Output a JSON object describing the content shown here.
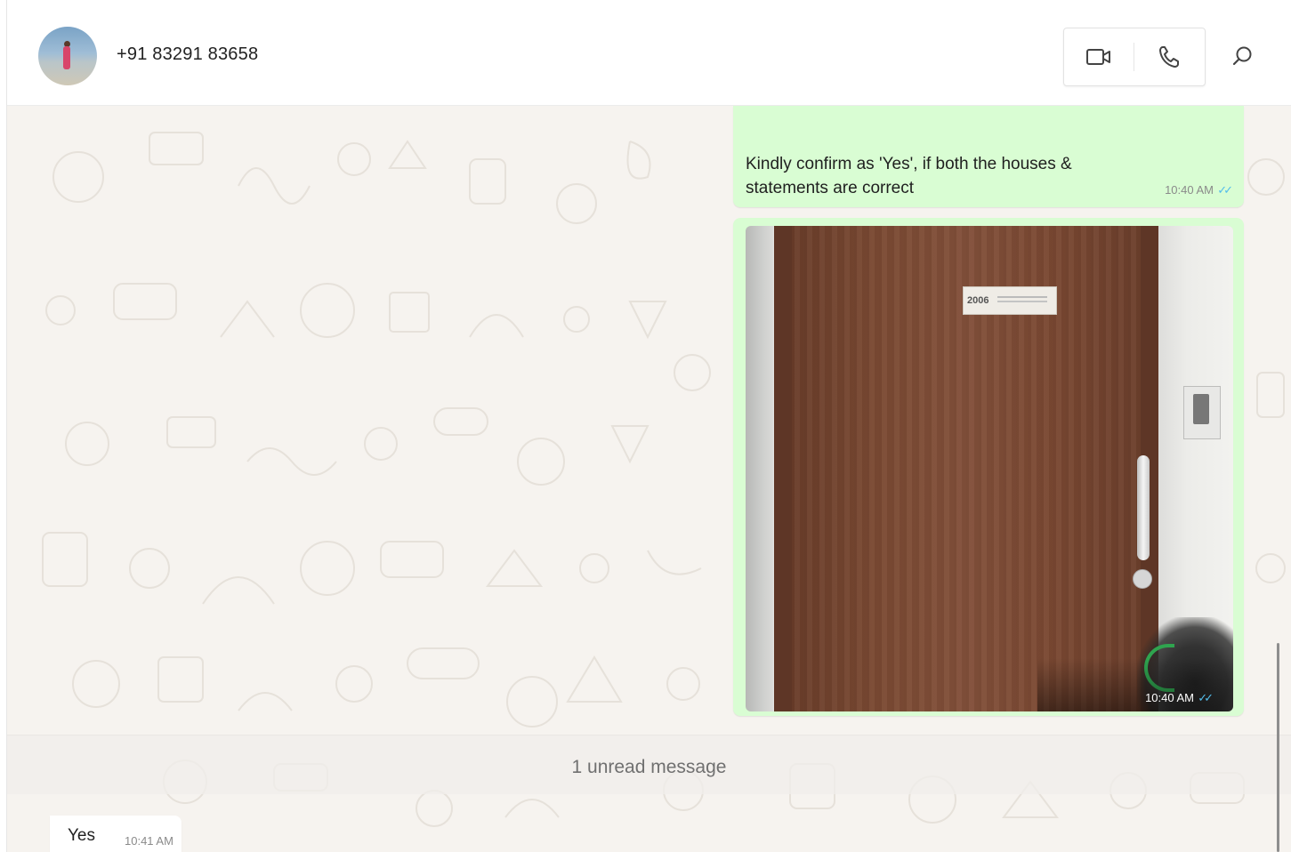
{
  "header": {
    "contact_name": "+91 83291 83658",
    "icons": {
      "video": "video-call-icon",
      "voice": "voice-call-icon",
      "search": "search-icon"
    }
  },
  "messages": {
    "outgoing_text": {
      "text": "Kindly confirm as 'Yes', if both the houses & statements are correct",
      "time": "10:40 AM",
      "status": "read"
    },
    "outgoing_image": {
      "plate_number": "2006",
      "time": "10:40 AM",
      "status": "read"
    },
    "unread_divider": "1 unread message",
    "incoming_text": {
      "text": "Yes",
      "time": "10:41 AM"
    }
  },
  "colors": {
    "outgoing_bubble": "#d9fdd3",
    "incoming_bubble": "#ffffff",
    "chat_background": "#f6f3ef",
    "read_ticks": "#53bdeb"
  }
}
